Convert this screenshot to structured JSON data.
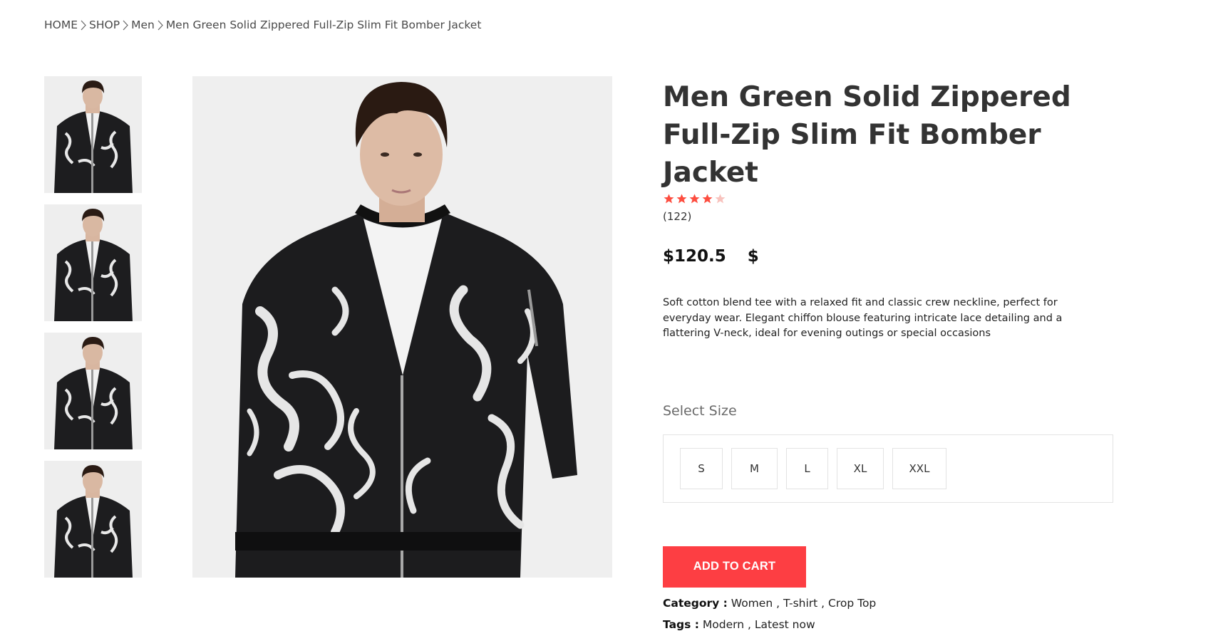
{
  "breadcrumb": {
    "items": [
      "HOME",
      "SHOP",
      "Men"
    ],
    "current": "Men Green Solid Zippered Full-Zip Slim Fit Bomber Jacket"
  },
  "product": {
    "title": "Men Green Solid Zippered Full-Zip Slim Fit Bomber Jacket",
    "rating": 4,
    "rating_max": 5,
    "reviews": "(122)",
    "price": "$120.5",
    "price_extra": "$",
    "description": "Soft cotton blend tee with a relaxed fit and classic crew neckline, perfect for everyday wear. Elegant chiffon blouse featuring intricate lace detailing and a flattering V-neck, ideal for evening outings or special occasions"
  },
  "size": {
    "label": "Select Size",
    "options": [
      "S",
      "M",
      "L",
      "XL",
      "XXL"
    ]
  },
  "actions": {
    "add_to_cart": "ADD TO CART"
  },
  "meta": {
    "category_label": "Category :",
    "categories": [
      "Women",
      "T-shirt",
      "Crop Top"
    ],
    "tags_label": "Tags :",
    "tags": [
      "Modern",
      "Latest now"
    ]
  },
  "icons": {
    "breadcrumb_separator": "chevron-right-icon",
    "star": "star-icon"
  },
  "colors": {
    "accent": "#fd3e43",
    "star_filled": "#fd4d3f",
    "star_empty": "#f8c3be",
    "image_bg": "#efefef"
  }
}
